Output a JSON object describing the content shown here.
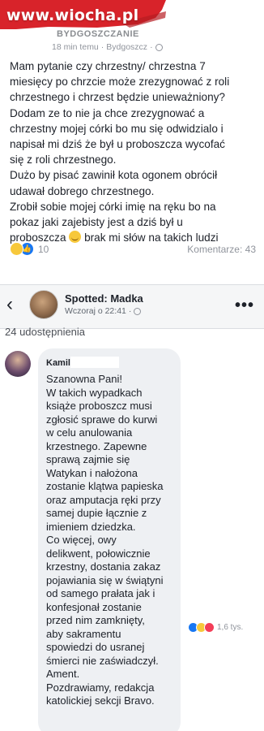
{
  "watermark": "www.wiocha.pl",
  "post1": {
    "author": "BYDGOSZCZANIE",
    "meta_time": "18 min temu",
    "meta_place": "Bydgoszcz",
    "body_lines": [
      "Mam pytanie czy chrzestny/ chrzestna 7",
      "miesięcy po chrzcie może zrezygnować z roli",
      "chrzestnego i chrzest będzie unieważniony?",
      "Dodam ze to nie ja chce zrezygnować a",
      "chrzestny mojej córki bo mu się odwidzialo i",
      "napisał mi dziś że był u proboszcza wycofać",
      "się z roli chrzestnego.",
      "Dużo by pisać zawinił kota ogonem obrócił",
      "udawał dobrego chrzestnego.",
      "Zrobił sobie mojej córki imię na ręku bo na",
      "pokaz jaki zajebisty jest a dziś był u"
    ],
    "last_line_start": "proboszcza",
    "last_line_end": "brak mi słów na takich ludzi",
    "reaction_count": "10",
    "comments": "Komentarze: 43"
  },
  "post2": {
    "back_symbol": "‹",
    "page_name": "Spotted: Madka",
    "page_meta": "Wczoraj o 22:41",
    "more_symbol": "•••",
    "shares": "24 udostępnienia",
    "comment_author": "Kamil",
    "comment_lines": [
      "Szanowna Pani!",
      "W takich wypadkach",
      "książe proboszcz musi",
      "zgłosić sprawe do kurwi",
      "w celu anulowania",
      "krzestnego. Zapewne",
      "sprawą zajmie się",
      "Watykan i nałożona",
      "zostanie klątwa papieska",
      "oraz amputacja ręki przy",
      "samej dupie łącznie z",
      "imieniem dziedzka.",
      "Co więcej, owy",
      "delikwent, połowicznie",
      "krzestny, dostania zakaz",
      "pojawiania się w świątyni",
      "od samego prałata jak i",
      "konfesjonał zostanie",
      "przed nim zamknięty,",
      "aby sakramentu",
      "spowiedzi do usranej",
      "śmierci nie zaświadczył.",
      "Ament.",
      "Pozdrawiamy, redakcja",
      "katolickiej sekcji Bravo."
    ],
    "comment_reactions": "1,6 tys."
  },
  "colors": {
    "watermark_red": "#d8232a",
    "facebook_blue": "#1877f2",
    "bubble_gray": "#eef0f3"
  },
  "icons": [
    "globe-icon",
    "haha-reaction-icon",
    "like-reaction-icon",
    "love-reaction-icon",
    "back-arrow-icon",
    "more-options-icon"
  ]
}
